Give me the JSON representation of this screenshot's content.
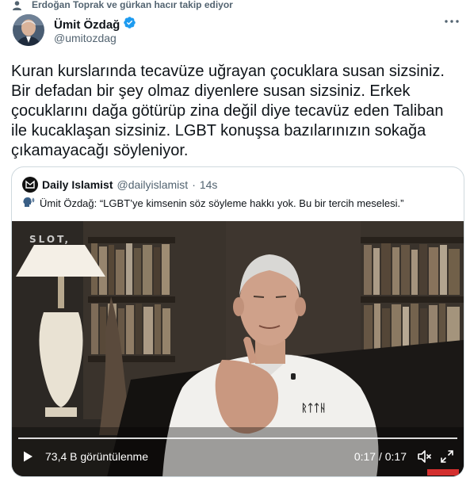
{
  "social_context": {
    "text": "Erdoğan Toprak ve gürkan hacır takip ediyor",
    "icon": "person-icon"
  },
  "author": {
    "display_name": "Ümit Özdağ",
    "handle": "@umitozdag",
    "verified": true
  },
  "tweet": {
    "lines": [
      "Kuran kurslarında tecavüze uğrayan çocuklara susan sizsiniz.",
      "Bir defadan bir şey olmaz diyenlere susan sizsiniz. Erkek",
      "çocuklarını dağa götürüp zina değil diye tecavüz eden Taliban",
      "ile kucaklaşan sizsiniz. LGBT konuşsa bazılarınızın sokağa",
      "çıkamayacağı söyleniyor."
    ]
  },
  "quote": {
    "name": "Daily Islamist",
    "handle": "@dailyislamist",
    "separator": "·",
    "time": "14s",
    "text": "Ümit Özdağ: “LGBT’ye kimsenin söz söyleme hakkı yok. Bu bir tercih meselesi.”",
    "speaker_emoji_icon": "speaking-head-icon"
  },
  "video": {
    "watermark": "SLOT,",
    "views": "73,4 B görüntülenme",
    "time": "0:17 / 0:17",
    "progress_fraction": 1.0,
    "shirt_text": "ᚱᛏᛏᚺ"
  },
  "colors": {
    "verified_blue": "#1d9bf0",
    "text_primary": "#0f1419",
    "text_secondary": "#536471",
    "border": "#cfd9de"
  }
}
